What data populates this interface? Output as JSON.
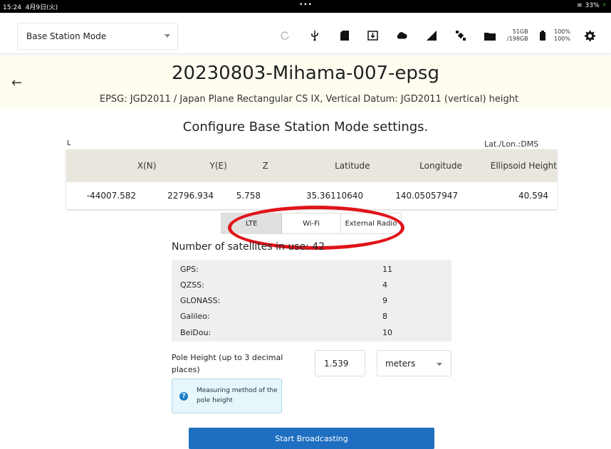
{
  "status_bar": {
    "time": "15:24",
    "date": "4月9日(火)",
    "dots": "•••",
    "battery": "33%"
  },
  "toolbar": {
    "mode_value": "Base Station Mode",
    "storage": {
      "used": "51GB",
      "total": "/198GB"
    },
    "percent_top": "100%",
    "percent_bottom": "100%",
    "icons": [
      "refresh-icon",
      "usb-icon",
      "sd-card-icon",
      "download-icon",
      "cloud-icon",
      "signal-icon",
      "satellite-icon",
      "folder-icon",
      "battery-icon",
      "gear-icon"
    ]
  },
  "header": {
    "back_label": "←",
    "title": "20230803-Mihama-007-epsg",
    "subtitle": "EPSG: JGD2011 / Japan Plane Rectangular CS IX, Vertical Datum: JGD2011 (vertical) height"
  },
  "main": {
    "section_title": "Configure Base Station Mode settings.",
    "label_l": "L",
    "latlon_format": "Lat./Lon.:DMS",
    "table": {
      "headers": [
        "X(N)",
        "Y(E)",
        "Z",
        "Latitude",
        "Longitude",
        "Ellipsoid Height"
      ],
      "row": [
        "-44007.582",
        "22796.934",
        "5.758",
        "35.36110640",
        "140.05057947",
        "40.594"
      ]
    },
    "tabs": [
      "LTE",
      "Wi-Fi",
      "External Radio"
    ],
    "satellites_title": "Number of satellites in use: 42",
    "satellites": [
      {
        "name": "GPS:",
        "count": "11"
      },
      {
        "name": "QZSS:",
        "count": "4"
      },
      {
        "name": "GLONASS:",
        "count": "9"
      },
      {
        "name": "Galileo:",
        "count": "8"
      },
      {
        "name": "BeiDou:",
        "count": "10"
      }
    ],
    "pole_height_label": "Pole Height (up to 3 decimal places)",
    "pole_height_value": "1.539",
    "unit_value": "meters",
    "info_text": "Measuring method of the pole height",
    "start_button": "Start Broadcasting"
  },
  "colors": {
    "accent": "#1e6fc1",
    "annotation": "#e0141a",
    "header_band": "#fffdf0"
  }
}
